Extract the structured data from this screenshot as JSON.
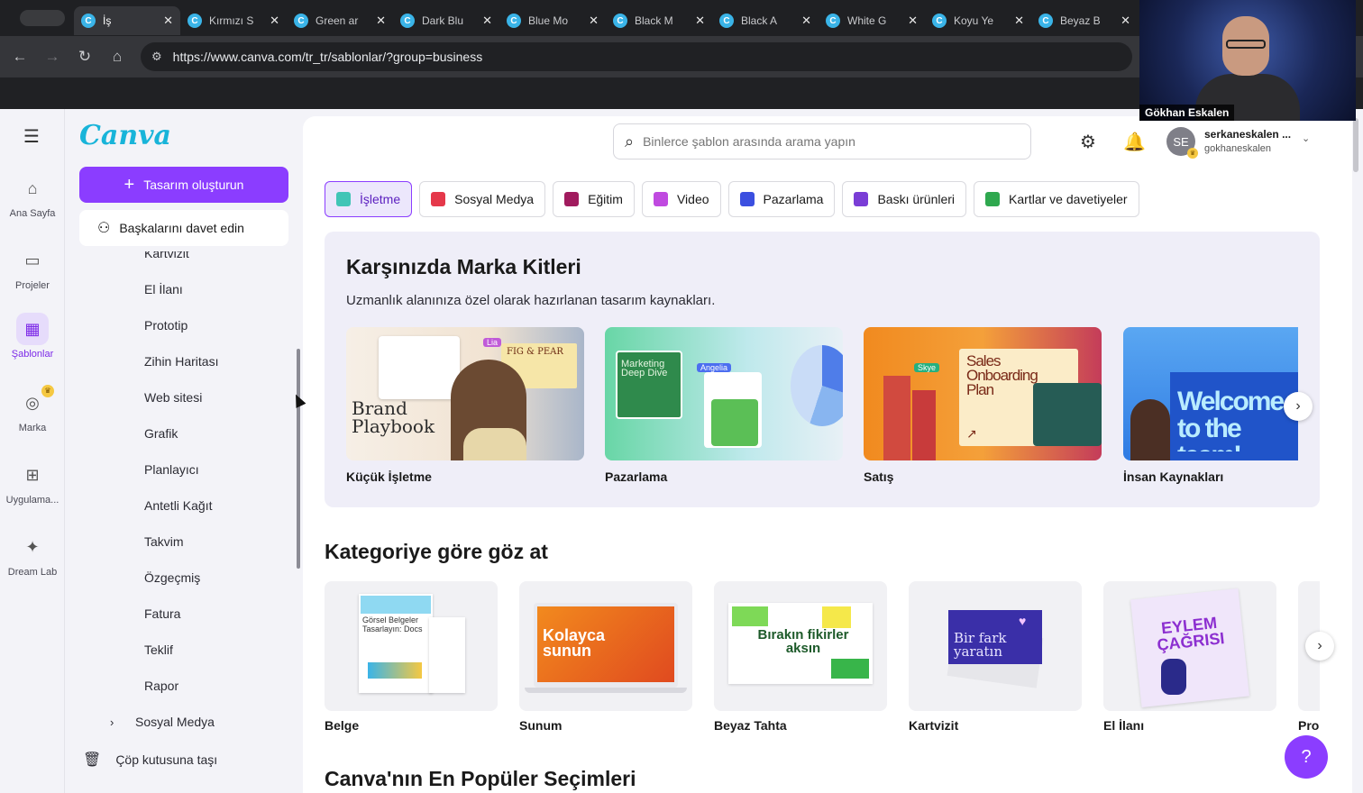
{
  "browser": {
    "tabs": [
      {
        "label": "İş",
        "active": true
      },
      {
        "label": "Kırmızı S",
        "active": false
      },
      {
        "label": "Green ar",
        "active": false
      },
      {
        "label": "Dark Blu",
        "active": false
      },
      {
        "label": "Blue Mo",
        "active": false
      },
      {
        "label": "Black M",
        "active": false
      },
      {
        "label": "Black A",
        "active": false
      },
      {
        "label": "White G",
        "active": false
      },
      {
        "label": "Koyu Ye",
        "active": false
      },
      {
        "label": "Beyaz B",
        "active": false
      }
    ],
    "url": "https://www.canva.com/tr_tr/sablonlar/?group=business"
  },
  "video": {
    "name": "Gökhan Eskalen"
  },
  "rail": {
    "items": [
      {
        "label": "Ana Sayfa",
        "icon": "home-icon"
      },
      {
        "label": "Projeler",
        "icon": "folder-icon"
      },
      {
        "label": "Şablonlar",
        "icon": "templates-icon",
        "active": true
      },
      {
        "label": "Marka",
        "icon": "brand-icon"
      },
      {
        "label": "Uygulama...",
        "icon": "apps-icon"
      },
      {
        "label": "Dream Lab",
        "icon": "dream-lab-icon"
      }
    ]
  },
  "panel": {
    "logo": "Canva",
    "create_label": "Tasarım oluşturun",
    "invite_label": "Başkalarını davet edin",
    "sub_items": [
      "Kartvizit",
      "El İlanı",
      "Prototip",
      "Zihin Haritası",
      "Web sitesi",
      "Grafik",
      "Planlayıcı",
      "Antetli Kağıt",
      "Takvim",
      "Özgeçmiş",
      "Fatura",
      "Teklif",
      "Rapor"
    ],
    "group_item": "Sosyal Medya",
    "trash_label": "Çöp kutusuna taşı"
  },
  "header": {
    "search_placeholder": "Binlerce şablon arasında arama yapın",
    "user_name": "serkaneskalen ...",
    "user_handle": "gokhaneskalen",
    "avatar_initials": "SE"
  },
  "chips": [
    {
      "label": "İşletme",
      "color": "#41c5b6",
      "active": true
    },
    {
      "label": "Sosyal Medya",
      "color": "#e5384a"
    },
    {
      "label": "Eğitim",
      "color": "#a11b5e"
    },
    {
      "label": "Video",
      "color": "#c04ae0"
    },
    {
      "label": "Pazarlama",
      "color": "#3b4fe0"
    },
    {
      "label": "Baskı ürünleri",
      "color": "#7a3dd6"
    },
    {
      "label": "Kartlar ve davetiyeler",
      "color": "#2fa84f"
    }
  ],
  "brand_kits": {
    "title": "Karşınızda Marka Kitleri",
    "subtitle": "Uzmanlık alanınıza özel olarak hazırlanan tasarım kaynakları.",
    "cards": [
      {
        "label": "Küçük İşletme",
        "art_title": "Brand Playbook",
        "art_tag": "FIG & PEAR",
        "art_chip": "Lia"
      },
      {
        "label": "Pazarlama",
        "art_title": "Marketing Deep Dive",
        "art_chip": "Angelia"
      },
      {
        "label": "Satış",
        "art_title": "Sales Onboarding Plan",
        "art_chip": "Skye"
      },
      {
        "label": "İnsan Kaynakları",
        "art_title": "Welcome to the team!"
      }
    ]
  },
  "categories": {
    "title": "Kategoriye göre göz at",
    "cards": [
      {
        "label": "Belge",
        "art": "Görsel Belgeler Tasarlayın: Docs"
      },
      {
        "label": "Sunum",
        "art": "Kolayca sunun"
      },
      {
        "label": "Beyaz Tahta",
        "art": "Bırakın fikirler aksın"
      },
      {
        "label": "Kartvizit",
        "art": "Bir fark yaratın"
      },
      {
        "label": "El İlanı",
        "art": "EYLEM ÇAĞRISI"
      },
      {
        "label": "Pro",
        "art": ""
      }
    ]
  },
  "popular": {
    "title": "Canva'nın En Popüler Seçimleri"
  },
  "help": {
    "label": "?"
  }
}
